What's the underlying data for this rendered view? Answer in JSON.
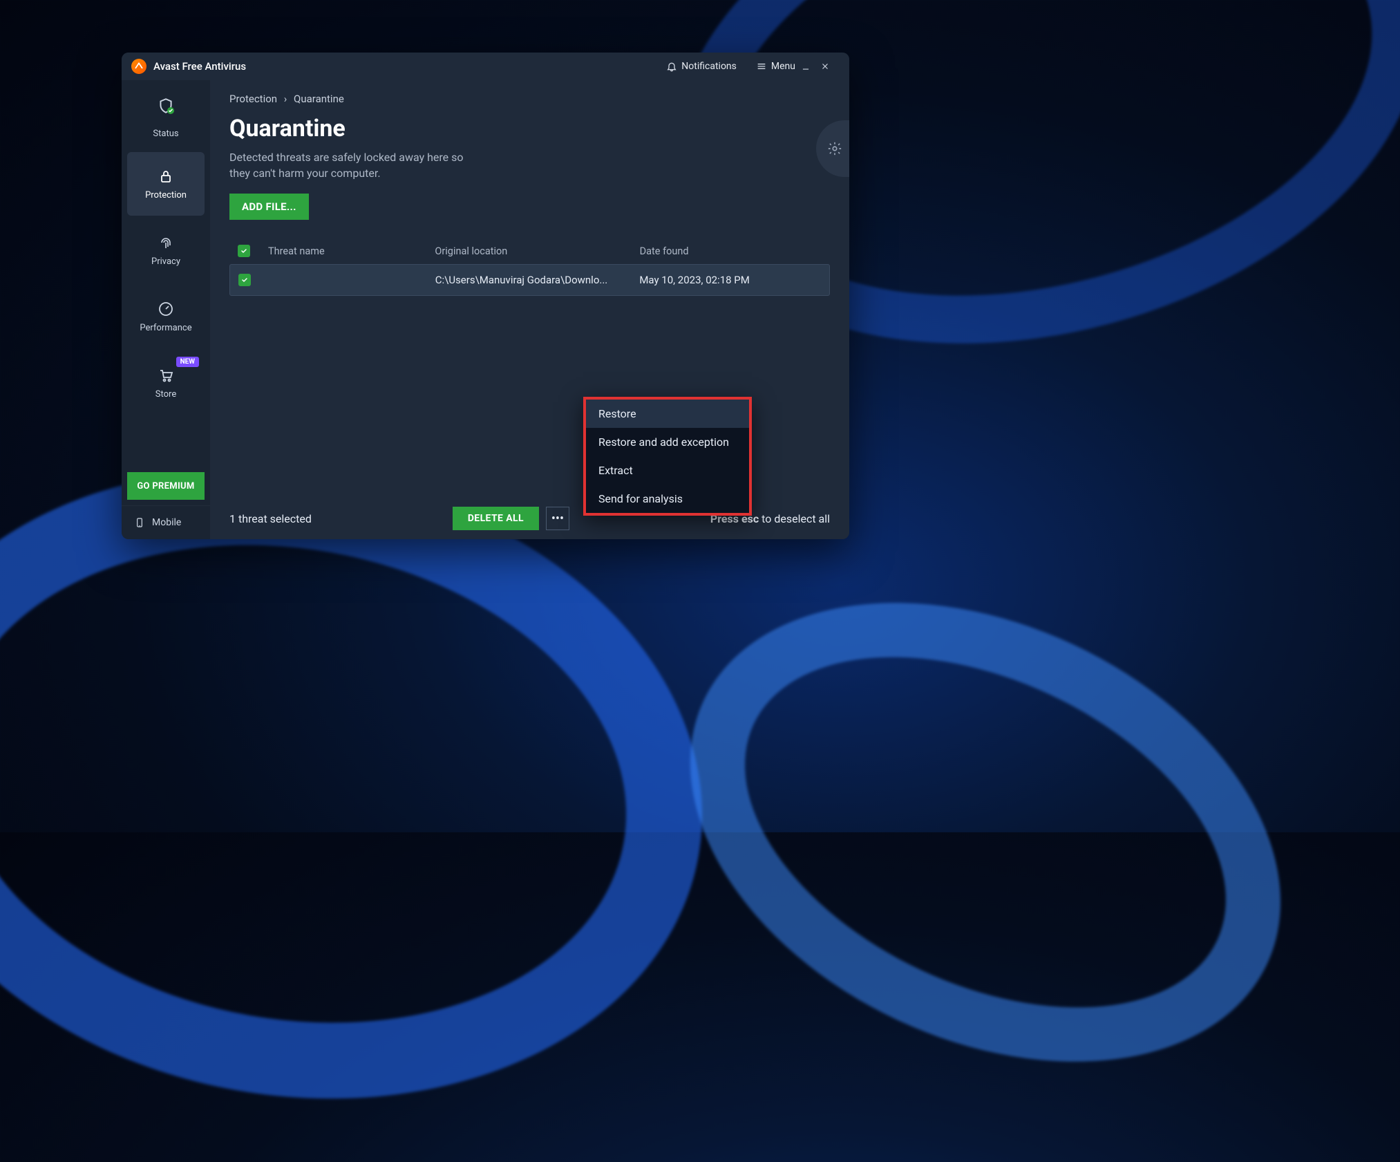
{
  "window": {
    "title": "Avast Free Antivirus",
    "notifications_label": "Notifications",
    "menu_label": "Menu"
  },
  "sidebar": {
    "items": [
      {
        "label": "Status"
      },
      {
        "label": "Protection"
      },
      {
        "label": "Privacy"
      },
      {
        "label": "Performance"
      },
      {
        "label": "Store",
        "badge": "NEW"
      }
    ],
    "go_premium_label": "GO PREMIUM",
    "mobile_label": "Mobile"
  },
  "breadcrumb": {
    "parent": "Protection",
    "sep": "›",
    "current": "Quarantine"
  },
  "page": {
    "title": "Quarantine",
    "description": "Detected threats are safely locked away here so they can't harm your computer.",
    "add_file_label": "ADD FILE..."
  },
  "columns": {
    "name": "Threat name",
    "location": "Original location",
    "date": "Date found"
  },
  "rows": [
    {
      "threat_name": "",
      "location": "C:\\Users\\Manuviraj Godara\\Downlo...",
      "date": "May 10, 2023, 02:18 PM"
    }
  ],
  "footer": {
    "selected_label": "1 threat selected",
    "delete_all_label": "DELETE ALL",
    "esc_hint_bold": "Press esc",
    "esc_hint_rest": " to deselect all"
  },
  "popup": {
    "items": [
      "Restore",
      "Restore and add exception",
      "Extract",
      "Send for analysis"
    ]
  }
}
